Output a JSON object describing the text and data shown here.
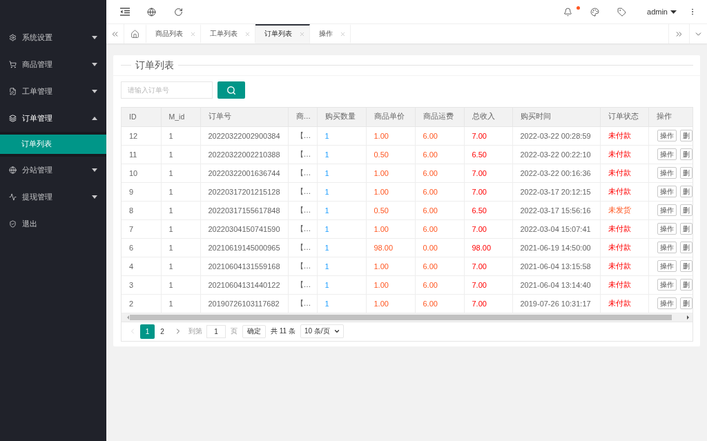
{
  "header": {
    "unread": true,
    "user": "admin"
  },
  "sidebar": {
    "items": [
      {
        "label": "系统设置",
        "expanded": false,
        "selected": false
      },
      {
        "label": "商品管理",
        "expanded": false,
        "selected": false
      },
      {
        "label": "工单管理",
        "expanded": false,
        "selected": false
      },
      {
        "label": "订单管理",
        "expanded": true,
        "selected": false,
        "children": [
          {
            "label": "订单列表",
            "selected": true
          }
        ]
      },
      {
        "label": "分站管理",
        "expanded": false,
        "selected": false
      },
      {
        "label": "提现管理",
        "expanded": false,
        "selected": false
      },
      {
        "label": "退出",
        "selected": false
      }
    ]
  },
  "tabs": [
    {
      "kind": "home",
      "selected": false
    },
    {
      "kind": "page",
      "label": "商品列表",
      "selected": false
    },
    {
      "kind": "page",
      "label": "工单列表",
      "selected": false
    },
    {
      "kind": "page",
      "label": "订单列表",
      "selected": true
    },
    {
      "kind": "page",
      "label": "操作",
      "selected": false
    }
  ],
  "card": {
    "title": "订单列表"
  },
  "search": {
    "placeholder": "请输入订单号"
  },
  "table": {
    "columns": [
      "ID",
      "M_id",
      "订单号",
      "商…",
      "购买数量",
      "商品单价",
      "商品运费",
      "总收入",
      "购买时间",
      "订单状态",
      "操作"
    ],
    "rows": [
      {
        "id": "12",
        "m_id": "1",
        "order_no": "20220322002900384",
        "product": "【…",
        "quantity": "1",
        "unit_price": "1.00",
        "shipping": "6.00",
        "total": "7.00",
        "time": "2022-03-22 00:28:59",
        "status": {
          "text": "未付款",
          "kind": "unpaid"
        },
        "actions": [
          "操作",
          "删"
        ]
      },
      {
        "id": "11",
        "m_id": "1",
        "order_no": "20220322002210388",
        "product": "【…",
        "quantity": "1",
        "unit_price": "0.50",
        "shipping": "6.00",
        "total": "6.50",
        "time": "2022-03-22 00:22:10",
        "status": {
          "text": "未付款",
          "kind": "unpaid"
        },
        "actions": [
          "操作",
          "删"
        ]
      },
      {
        "id": "10",
        "m_id": "1",
        "order_no": "20220322001636744",
        "product": "【…",
        "quantity": "1",
        "unit_price": "1.00",
        "shipping": "6.00",
        "total": "7.00",
        "time": "2022-03-22 00:16:36",
        "status": {
          "text": "未付款",
          "kind": "unpaid"
        },
        "actions": [
          "操作",
          "删"
        ]
      },
      {
        "id": "9",
        "m_id": "1",
        "order_no": "20220317201215128",
        "product": "【…",
        "quantity": "1",
        "unit_price": "1.00",
        "shipping": "6.00",
        "total": "7.00",
        "time": "2022-03-17 20:12:15",
        "status": {
          "text": "未付款",
          "kind": "unpaid"
        },
        "actions": [
          "操作",
          "删"
        ]
      },
      {
        "id": "8",
        "m_id": "1",
        "order_no": "20220317155617848",
        "product": "【…",
        "quantity": "1",
        "unit_price": "0.50",
        "shipping": "6.00",
        "total": "6.50",
        "time": "2022-03-17 15:56:16",
        "status": {
          "text": "未发货",
          "kind": "unshipped"
        },
        "actions": [
          "操作",
          "删"
        ]
      },
      {
        "id": "7",
        "m_id": "1",
        "order_no": "20220304150741590",
        "product": "【…",
        "quantity": "1",
        "unit_price": "1.00",
        "shipping": "6.00",
        "total": "7.00",
        "time": "2022-03-04 15:07:41",
        "status": {
          "text": "未付款",
          "kind": "unpaid"
        },
        "actions": [
          "操作",
          "删"
        ]
      },
      {
        "id": "6",
        "m_id": "1",
        "order_no": "20210619145000965",
        "product": "【…",
        "quantity": "1",
        "unit_price": "98.00",
        "shipping": "0.00",
        "total": "98.00",
        "time": "2021-06-19 14:50:00",
        "status": {
          "text": "未付款",
          "kind": "unpaid"
        },
        "actions": [
          "操作",
          "删"
        ]
      },
      {
        "id": "4",
        "m_id": "1",
        "order_no": "20210604131559168",
        "product": "【…",
        "quantity": "1",
        "unit_price": "1.00",
        "shipping": "6.00",
        "total": "7.00",
        "time": "2021-06-04 13:15:58",
        "status": {
          "text": "未付款",
          "kind": "unpaid"
        },
        "actions": [
          "操作",
          "删"
        ]
      },
      {
        "id": "3",
        "m_id": "1",
        "order_no": "20210604131440122",
        "product": "【…",
        "quantity": "1",
        "unit_price": "1.00",
        "shipping": "6.00",
        "total": "7.00",
        "time": "2021-06-04 13:14:40",
        "status": {
          "text": "未付款",
          "kind": "unpaid"
        },
        "actions": [
          "操作",
          "删"
        ]
      },
      {
        "id": "2",
        "m_id": "1",
        "order_no": "20190726103117682",
        "product": "【…",
        "quantity": "1",
        "unit_price": "1.00",
        "shipping": "6.00",
        "total": "7.00",
        "time": "2019-07-26 10:31:17",
        "status": {
          "text": "未付款",
          "kind": "unpaid"
        },
        "actions": [
          "操作",
          "删"
        ]
      }
    ]
  },
  "pagination": {
    "prev": {
      "disabled": true
    },
    "pages": [
      {
        "label": "1",
        "selected": true
      },
      {
        "label": "2",
        "selected": false
      }
    ],
    "next": {
      "disabled": false
    },
    "goto_label": "到第",
    "goto_value": "1",
    "page_label": "页",
    "confirm": "确定",
    "total": "共 11 条",
    "page_size": "10 条/页"
  }
}
